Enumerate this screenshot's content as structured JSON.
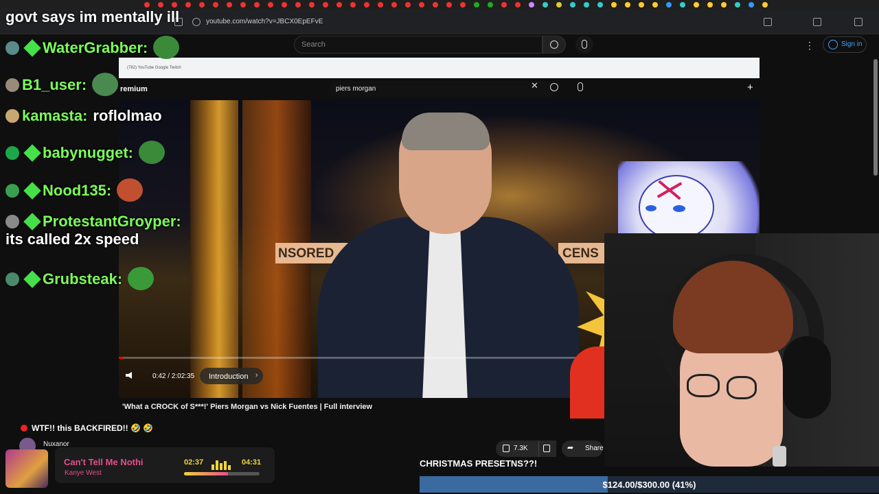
{
  "browser": {
    "url": "youtube.com/watch?v=JBCX0EpEFvE"
  },
  "youtube": {
    "search_placeholder": "Search",
    "signin_label": "Sign in"
  },
  "inner": {
    "bookmarks": "(782) YouTube    Google    Twitch",
    "premium_label": "remium",
    "search_value": "piers morgan"
  },
  "video": {
    "time": "0:42 / 2:02:35",
    "chapter": "Introduction",
    "banner_left": "NSORED",
    "banner_right": "CENS",
    "progress": 0.006,
    "title": "'What a CROCK of S***!' Piers Morgan vs Nick Fuentes | Full interview",
    "channel": "Nuxanor",
    "likes": "7.3K",
    "share_label": "Share"
  },
  "chat": {
    "donation_header": "govt says im mentally ill",
    "messages": [
      {
        "user": "WaterGrabber:",
        "text": "",
        "user_color": "#7cff5a"
      },
      {
        "user": "B1_user:",
        "text": "",
        "user_color": "#7cff5a"
      },
      {
        "user": "kamasta:",
        "text": "roflolmao",
        "user_color": "#7cff5a"
      },
      {
        "user": "babynugget:",
        "text": "",
        "user_color": "#7cff5a"
      },
      {
        "user": "Nood135:",
        "text": "",
        "user_color": "#7cff5a"
      },
      {
        "user": "ProtestantGroyper:",
        "text": "its called 2x speed",
        "user_color": "#7cff5a"
      },
      {
        "user": "Grubsteak:",
        "text": "",
        "user_color": "#7cff5a"
      }
    ]
  },
  "alert": {
    "text": "WTF!! this BACKFIRED!! 🤣 🤣"
  },
  "music": {
    "song": "Can't Tell Me Nothi",
    "artist": "Kanye West",
    "elapsed": "02:37",
    "total": "04:31",
    "progress": 0.58
  },
  "goal": {
    "title": "CHRISTMAS PRESETNS??!",
    "text": "$124.00/$300.00 (41%)",
    "progress": 0.41
  }
}
